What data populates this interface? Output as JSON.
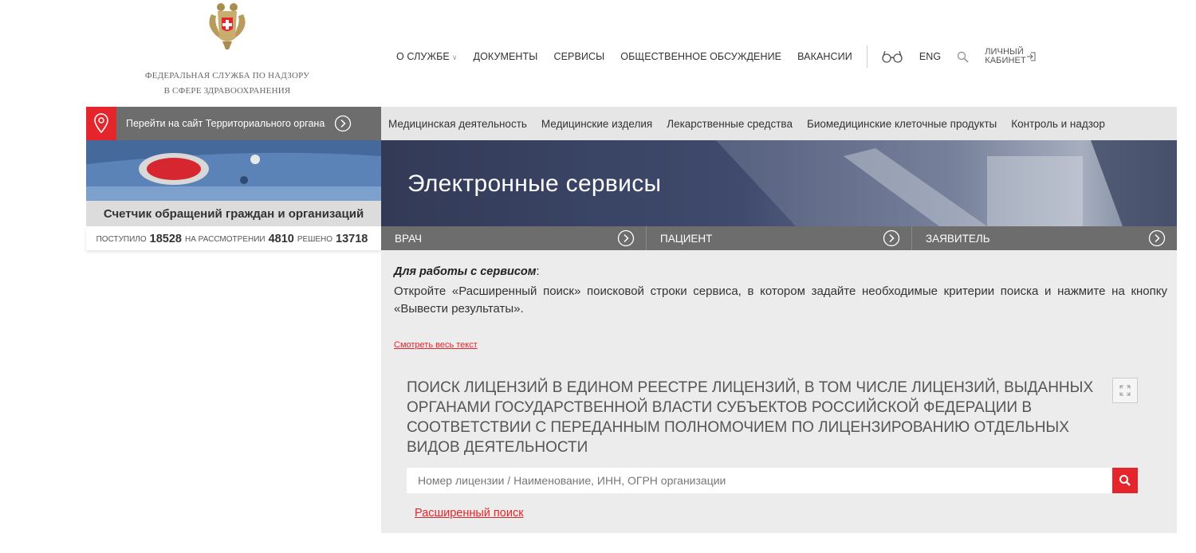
{
  "header": {
    "logo_text_line1": "ФЕДЕРАЛЬНАЯ СЛУЖБА ПО НАДЗОРУ",
    "logo_text_line2": "В СФЕРЕ ЗДРАВООХРАНЕНИЯ",
    "nav": [
      {
        "label": "О СЛУЖБЕ",
        "icon": "chevron-down-icon"
      },
      {
        "label": "ДОКУМЕНТЫ"
      },
      {
        "label": "СЕРВИСЫ"
      },
      {
        "label": "ОБЩЕСТВЕННОЕ ОБСУЖДЕНИЕ"
      },
      {
        "label": "ВАКАНСИИ"
      }
    ],
    "lang": "ENG",
    "cabinet_line1": "ЛИЧНЫЙ",
    "cabinet_line2": "КАБИНЕТ"
  },
  "territorial": {
    "label": "Перейти на сайт Территориального органа"
  },
  "categories": [
    "Медицинская деятельность",
    "Медицинские изделия",
    "Лекарственные средства",
    "Биомедицинские клеточные продукты",
    "Контроль и надзор"
  ],
  "counter": {
    "title": "Счетчик обращений граждан и организаций",
    "received_label": "ПОСТУПИЛО",
    "received": "18528",
    "review_label": "НА РАССМОТРЕНИИ",
    "review": "4810",
    "solved_label": "РЕШЕНО",
    "solved": "13718"
  },
  "hero": {
    "title": "Электронные сервисы"
  },
  "tabs": [
    "ВРАЧ",
    "ПАЦИЕНТ",
    "ЗАЯВИТЕЛЬ"
  ],
  "content": {
    "info_title": "Для работы с сервисом",
    "info_colon": ":",
    "info_text": "Откройте «Расширенный поиск» поисковой строки сервиса, в котором задайте необходимые критерии поиска и нажмите на кнопку «Вывести результаты».",
    "more_link": "Смотреть весь текст",
    "search_title": "Поиск лицензий в едином реестре лицензий, в том числе лицензий, выданных органами государственной власти субъектов Российской Федерации в соответствии с переданным полномочием по лицензированию отдельных видов деятельности",
    "search_placeholder": "Номер лицензии / Наименование, ИНН, ОГРН организации",
    "advanced_link": "Расширенный поиск"
  },
  "colors": {
    "accent": "#e4262c",
    "strip_gray": "#6d6d6d",
    "content_bg": "#ececec"
  }
}
